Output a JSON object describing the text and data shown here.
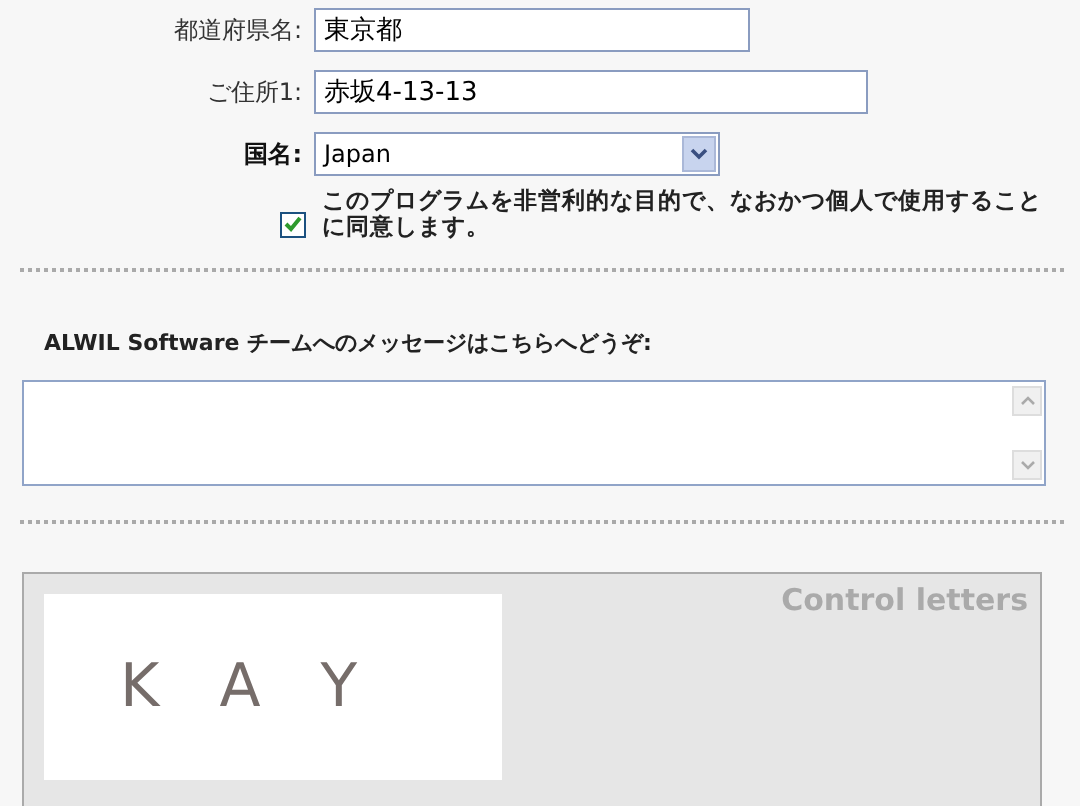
{
  "fields": [
    {
      "kind": "text",
      "label": "都道府県名:",
      "value": "東京都",
      "bold": false
    },
    {
      "kind": "text",
      "label": "ご住所1:",
      "value": "赤坂4-13-13",
      "bold": false
    },
    {
      "kind": "select",
      "label": "国名:",
      "value": "Japan",
      "bold": true
    }
  ],
  "consent": {
    "checked": true,
    "text": "このプログラムを非営利的な目的で、なおかつ個人で使用することに同意します。"
  },
  "message": {
    "label": "ALWIL Software チームへのメッセージはこちらへどうぞ:"
  },
  "captcha": {
    "title": "Control letters",
    "letters": [
      "K",
      "A",
      "Y"
    ]
  }
}
